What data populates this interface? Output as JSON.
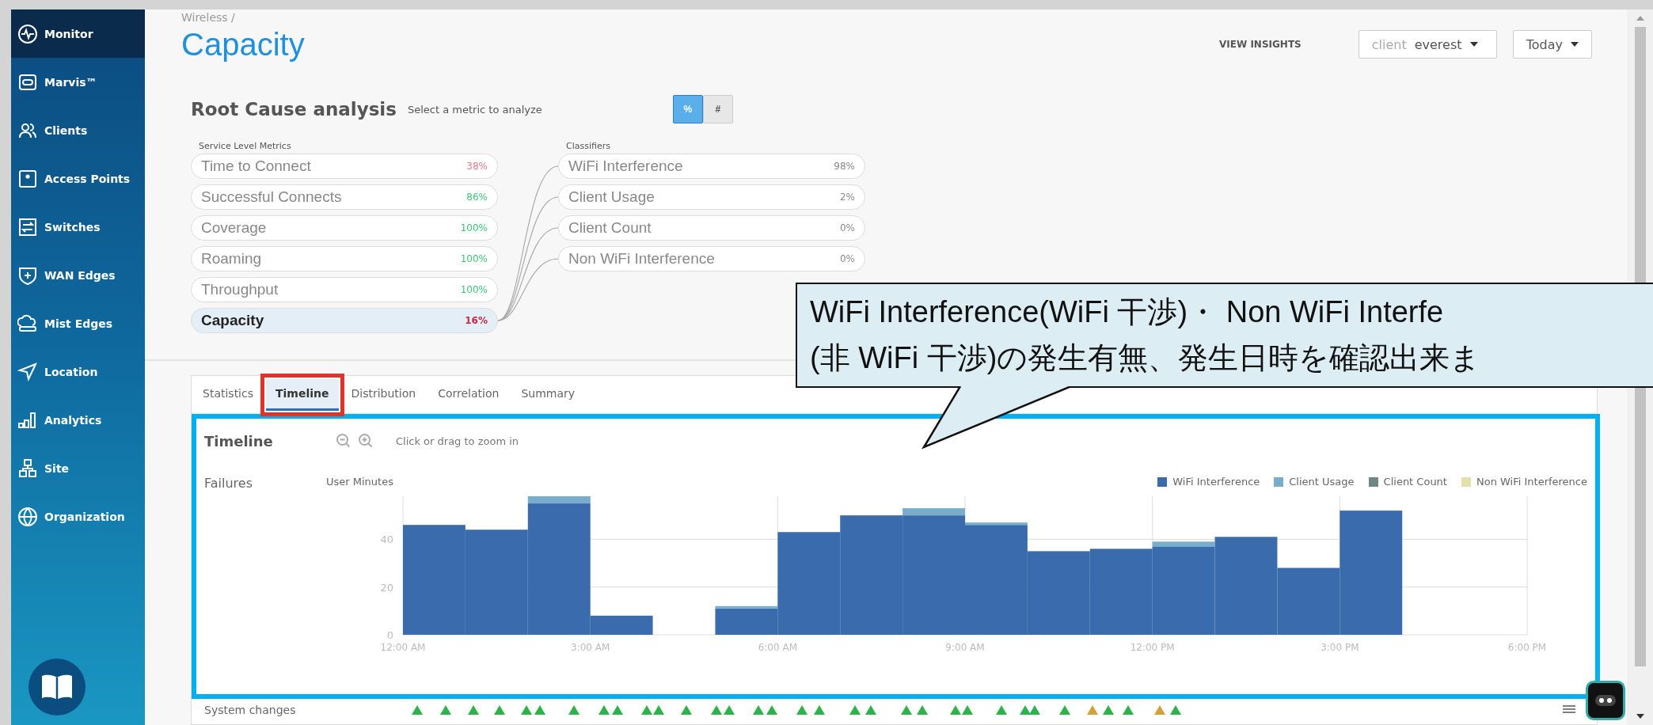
{
  "breadcrumb": "Wireless /",
  "title": "Capacity",
  "header": {
    "insights": "VIEW INSIGHTS",
    "client_filter": {
      "prefix": "client",
      "value": "everest"
    },
    "period": "Today"
  },
  "sidebar": {
    "items": [
      {
        "label": "Monitor",
        "selected": true
      },
      {
        "label": "Marvis™",
        "selected": false
      },
      {
        "label": "Clients",
        "selected": false
      },
      {
        "label": "Access Points",
        "selected": false
      },
      {
        "label": "Switches",
        "selected": false
      },
      {
        "label": "WAN Edges",
        "selected": false
      },
      {
        "label": "Mist Edges",
        "selected": false
      },
      {
        "label": "Location",
        "selected": false
      },
      {
        "label": "Analytics",
        "selected": false
      },
      {
        "label": "Site",
        "selected": false
      },
      {
        "label": "Organization",
        "selected": false
      }
    ]
  },
  "root_cause": {
    "title": "Root Cause analysis",
    "subtitle": "Select a metric to analyze",
    "toggle": [
      {
        "label": "%",
        "selected": true
      },
      {
        "label": "#",
        "selected": false
      }
    ],
    "metrics_heading": "Service Level Metrics",
    "metrics": [
      {
        "name": "Time to Connect",
        "value": "38%",
        "color": "#e57a8a",
        "selected": false
      },
      {
        "name": "Successful Connects",
        "value": "86%",
        "color": "#3ec47a",
        "selected": false
      },
      {
        "name": "Coverage",
        "value": "100%",
        "color": "#3ec47a",
        "selected": false
      },
      {
        "name": "Roaming",
        "value": "100%",
        "color": "#3ec47a",
        "selected": false
      },
      {
        "name": "Throughput",
        "value": "100%",
        "color": "#3ec47a",
        "selected": false
      },
      {
        "name": "Capacity",
        "value": "16%",
        "color": "#c8284a",
        "selected": true
      }
    ],
    "classifiers_heading": "Classifiers",
    "classifiers": [
      {
        "name": "WiFi Interference",
        "value": "98%"
      },
      {
        "name": "Client Usage",
        "value": "2%"
      },
      {
        "name": "Client Count",
        "value": "0%"
      },
      {
        "name": "Non WiFi Interference",
        "value": "0%"
      }
    ]
  },
  "tabs": [
    {
      "label": "Statistics",
      "selected": false,
      "outlined": false
    },
    {
      "label": "Timeline",
      "selected": true,
      "outlined": true
    },
    {
      "label": "Distribution",
      "selected": false,
      "outlined": false
    },
    {
      "label": "Correlation",
      "selected": false,
      "outlined": false
    },
    {
      "label": "Summary",
      "selected": false,
      "outlined": false
    }
  ],
  "timeline": {
    "title": "Timeline",
    "hint": "Click or drag to zoom in",
    "row_label": "Failures",
    "outlined": true,
    "chart_data": {
      "type": "bar",
      "ylabel": "User Minutes",
      "stacked": true,
      "x": [
        0.5,
        1.5,
        2.5,
        3.5,
        4.5,
        5.5,
        6.5,
        7.5,
        8.5,
        9.5,
        10.5,
        11.5,
        12.5,
        13.5,
        14.5,
        15.5
      ],
      "grid": true,
      "legend": "top-right",
      "xlim": [
        0,
        18
      ],
      "ylim": [
        0,
        58
      ],
      "xticks": [
        {
          "value": 0,
          "label": "12:00 AM"
        },
        {
          "value": 3,
          "label": "3:00 AM"
        },
        {
          "value": 6,
          "label": "6:00 AM"
        },
        {
          "value": 9,
          "label": "9:00 AM"
        },
        {
          "value": 12,
          "label": "12:00 PM"
        },
        {
          "value": 15,
          "label": "3:00 PM"
        },
        {
          "value": 18,
          "label": "6:00 PM"
        }
      ],
      "yticks": [
        0,
        20,
        40
      ],
      "series": [
        {
          "name": "WiFi Interference",
          "color": "#3a6cad",
          "values": [
            46,
            44,
            55,
            8,
            0,
            11,
            43,
            50,
            50,
            46,
            35,
            36,
            37,
            41,
            28,
            52
          ]
        },
        {
          "name": "Client Usage",
          "color": "#78aecb",
          "values": [
            0,
            0,
            3,
            0,
            0,
            1,
            0,
            0,
            3,
            1,
            0,
            0,
            2,
            0,
            0,
            0
          ]
        },
        {
          "name": "Client Count",
          "color": "#6f8886",
          "values": [
            0,
            0,
            0,
            0,
            0,
            0,
            0,
            0,
            0,
            0,
            0,
            0,
            0,
            0,
            0,
            0
          ]
        },
        {
          "name": "Non WiFi Interference",
          "color": "#e6dfab",
          "values": [
            0,
            0,
            0,
            0,
            0,
            0,
            0,
            0,
            0,
            0,
            0,
            0,
            0,
            0,
            0,
            0
          ]
        }
      ]
    }
  },
  "system_changes": {
    "label": "System changes"
  },
  "callout": {
    "lines": [
      "WiFi Interference(WiFi 干渉)・ Non WiFi Interfe",
      "(非 WiFi 干渉)の発生有無、発生日時を確認出来ま"
    ]
  }
}
